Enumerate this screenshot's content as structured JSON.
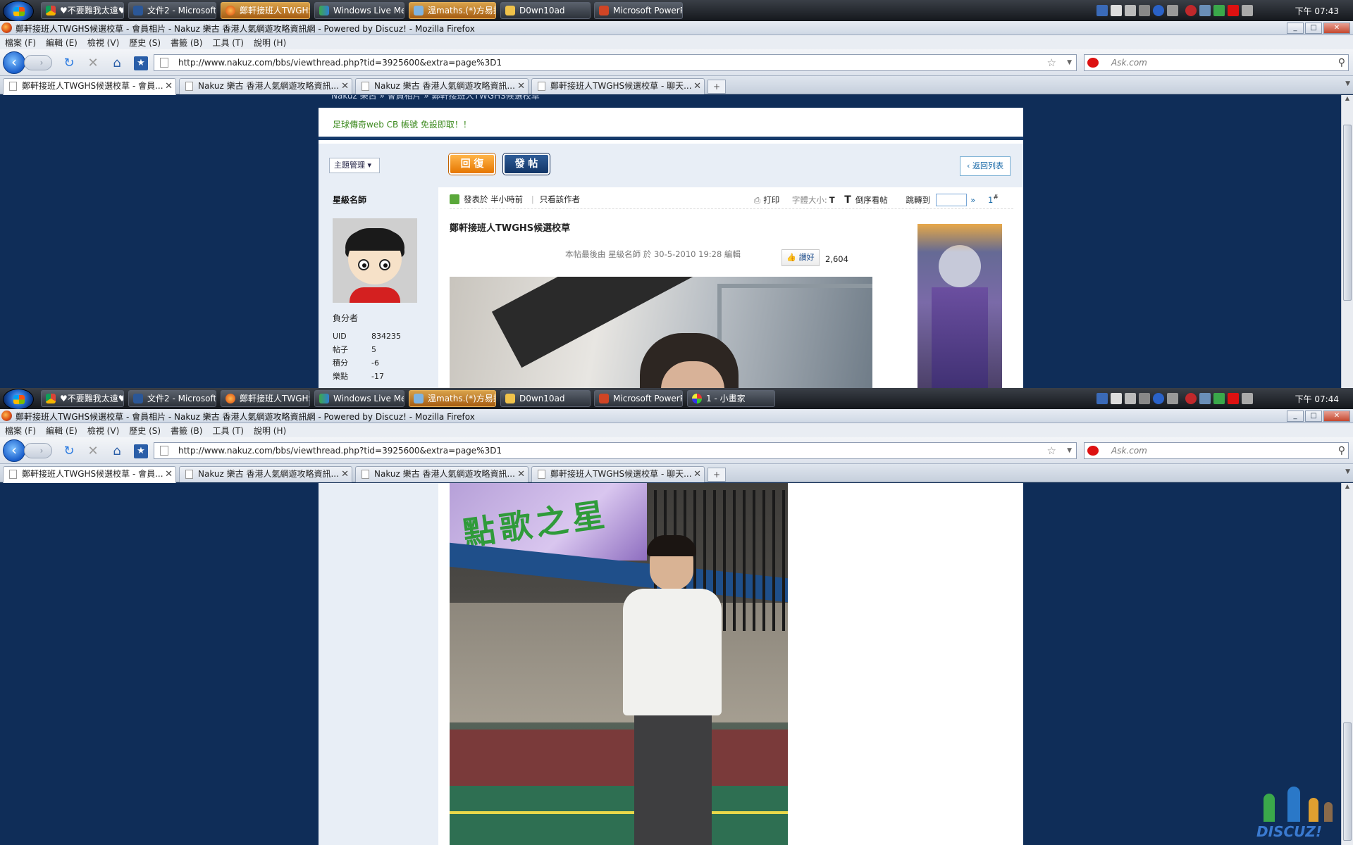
{
  "screens": [
    {
      "taskbar": {
        "buttons": [
          {
            "label": "♥不要難我太遠♥ - G...",
            "icon": "chrome-icon",
            "active": false
          },
          {
            "label": "文件2 - Microsoft W...",
            "icon": "word-icon",
            "active": false
          },
          {
            "label": "鄭軒接班人TWGHS...",
            "icon": "firefox-icon",
            "active": true
          },
          {
            "label": "Windows Live Mess...",
            "icon": "messenger-icon",
            "active": false
          },
          {
            "label": "溫maths.(*)方易掙 <...",
            "icon": "chat-icon",
            "active": false
          },
          {
            "label": "D0wn10ad",
            "icon": "folder-icon",
            "active": false
          },
          {
            "label": "Microsoft PowerPoi...",
            "icon": "powerpoint-icon",
            "active": false
          }
        ],
        "clock": "下午 07:43"
      },
      "window_title": "鄭軒接班人TWGHS候選校草 - 會員相片 - Nakuz 樂古 香港人氣網遊攻略資訊網 - Powered by Discuz! - Mozilla Firefox"
    },
    {
      "taskbar": {
        "buttons": [
          {
            "label": "♥不要難我太遠♥ - G...",
            "icon": "chrome-icon",
            "active": false
          },
          {
            "label": "文件2 - Microsoft W...",
            "icon": "word-icon",
            "active": false
          },
          {
            "label": "鄭軒接班人TWGHS...",
            "icon": "firefox-icon",
            "active": false
          },
          {
            "label": "Windows Live Mess...",
            "icon": "messenger-icon",
            "active": false
          },
          {
            "label": "溫maths.(*)方易掙 <...",
            "icon": "chat-icon",
            "active": true
          },
          {
            "label": "D0wn10ad",
            "icon": "folder-icon",
            "active": false
          },
          {
            "label": "Microsoft PowerPoi...",
            "icon": "powerpoint-icon",
            "active": false
          },
          {
            "label": "1 - 小畫家",
            "icon": "paint-icon",
            "active": false
          }
        ],
        "clock": "下午 07:44"
      },
      "window_title": "鄭軒接班人TWGHS候選校草 - 會員相片 - Nakuz 樂古 香港人氣網遊攻略資訊網 - Powered by Discuz! - Mozilla Firefox"
    }
  ],
  "browser": {
    "menu": [
      "檔案 (F)",
      "編輯 (E)",
      "檢視 (V)",
      "歷史 (S)",
      "書籤 (B)",
      "工具 (T)",
      "說明 (H)"
    ],
    "url": "http://www.nakuz.com/bbs/viewthread.php?tid=3925600&extra=page%3D1",
    "search_placeholder": "Ask.com",
    "tabs": [
      {
        "label": "鄭軒接班人TWGHS候選校草 - 會員...",
        "selected": true
      },
      {
        "label": "Nakuz 樂古 香港人氣網遊攻略資訊...",
        "selected": false
      },
      {
        "label": "Nakuz 樂古 香港人氣網遊攻略資訊...",
        "selected": false
      },
      {
        "label": "鄭軒接班人TWGHS候選校草 - 聊天...",
        "selected": false
      }
    ],
    "newtab": "+"
  },
  "page": {
    "breadcrumb": "Nakuz 樂古 » 會員相片 » 鄭軒接班人TWGHS候選校草",
    "notice": "足球傳奇web CB 帳號 免設即取！！",
    "thread_manage": "主題管理",
    "reply_button": "回 復",
    "post_button": "發 帖",
    "back_to_list": "返回列表",
    "author": "星級名師",
    "role": "負分者",
    "stats": [
      {
        "key": "UID",
        "value": "834235"
      },
      {
        "key": "帖子",
        "value": "5"
      },
      {
        "key": "積分",
        "value": "-6"
      },
      {
        "key": "樂點",
        "value": "-17"
      }
    ],
    "post_meta": {
      "posted": "發表於 半小時前",
      "only_author": "只看該作者",
      "print": "打印",
      "font_size": "字體大小:",
      "font_t": "T",
      "reverse": "倒序看帖",
      "jump": "跳轉到",
      "go": "»",
      "floor": "1",
      "floor_sup": "#"
    },
    "post_title": "鄭軒接班人TWGHS候選校草",
    "edited": "本帖最後由 星級名師 於 30-5-2010 19:28 編輯",
    "like_label": "讚好",
    "like_count": "2,604",
    "banner_text": "點歌之星",
    "watermark": "DISCUZ!"
  }
}
